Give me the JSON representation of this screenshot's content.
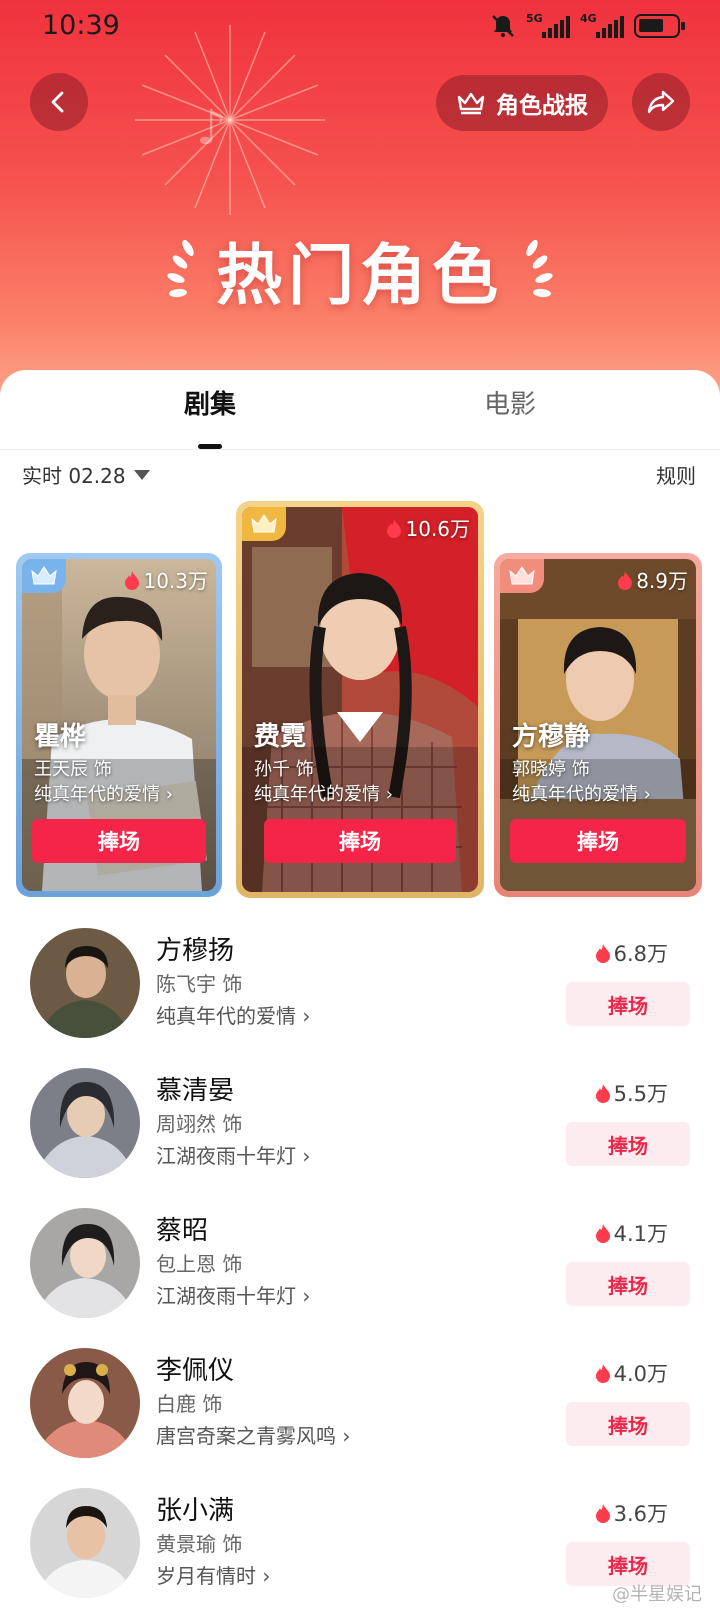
{
  "status_bar": {
    "time": "10:39",
    "net1": "5G",
    "net2": "4G"
  },
  "header": {
    "report_label": "角色战报",
    "title": "热门角色"
  },
  "tabs": [
    {
      "label": "剧集",
      "active": true
    },
    {
      "label": "电影",
      "active": false
    }
  ],
  "filter": {
    "label": "实时 02.28",
    "rules_label": "规则"
  },
  "top_cards": [
    {
      "rank": 2,
      "heat": "10.3万",
      "name": "瞿桦",
      "actor": "王天辰 饰",
      "drama": "纯真年代的爱情",
      "cheer_label": "捧场"
    },
    {
      "rank": 1,
      "heat": "10.6万",
      "name": "费霓",
      "actor": "孙千 饰",
      "drama": "纯真年代的爱情",
      "cheer_label": "捧场"
    },
    {
      "rank": 3,
      "heat": "8.9万",
      "name": "方穆静",
      "actor": "郭晓婷 饰",
      "drama": "纯真年代的爱情",
      "cheer_label": "捧场"
    }
  ],
  "list": [
    {
      "name": "方穆扬",
      "actor": "陈飞宇 饰",
      "drama": "纯真年代的爱情",
      "heat": "6.8万",
      "cheer_label": "捧场"
    },
    {
      "name": "慕清晏",
      "actor": "周翊然 饰",
      "drama": "江湖夜雨十年灯",
      "heat": "5.5万",
      "cheer_label": "捧场"
    },
    {
      "name": "蔡昭",
      "actor": "包上恩 饰",
      "drama": "江湖夜雨十年灯",
      "heat": "4.1万",
      "cheer_label": "捧场"
    },
    {
      "name": "李佩仪",
      "actor": "白鹿 饰",
      "drama": "唐宫奇案之青雾风鸣",
      "heat": "4.0万",
      "cheer_label": "捧场"
    },
    {
      "name": "张小满",
      "actor": "黄景瑜 饰",
      "drama": "岁月有情时",
      "heat": "3.6万",
      "cheer_label": "捧场"
    }
  ],
  "watermark": "@半星娱记",
  "colors": {
    "accent": "#f5254a",
    "header_top": "#f0323e",
    "card_silver": "#6aa2da",
    "card_gold": "#e0b566",
    "card_bronze": "#e78477"
  }
}
